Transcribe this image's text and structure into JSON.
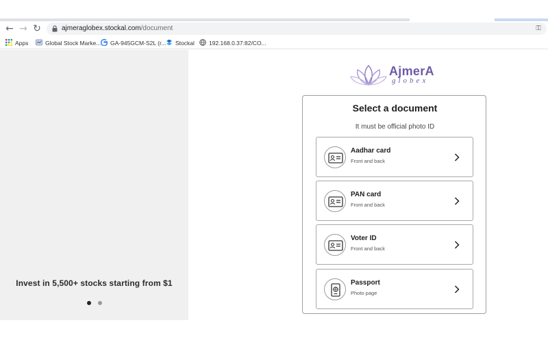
{
  "browser": {
    "url_host": "ajmeraglobex.stockal.com",
    "url_path": "/document",
    "bookmarks": [
      {
        "label": "Apps",
        "icon": "apps-grid-icon"
      },
      {
        "label": "Global Stock Marke...",
        "icon": "page-icon"
      },
      {
        "label": "GA-945GCM-S2L (r...",
        "icon": "google-icon"
      },
      {
        "label": "Stockal",
        "icon": "stockal-icon"
      },
      {
        "label": "192.168.0.37:82/CO...",
        "icon": "globe-icon"
      }
    ]
  },
  "left_panel": {
    "promo_text": "Invest in 5,500+ stocks starting from $1",
    "slides": 2,
    "active_slide": 1
  },
  "logo": {
    "name": "AjmerA",
    "tagline": "globex"
  },
  "document_picker": {
    "title": "Select a document",
    "subtitle": "It must be official photo ID",
    "options": [
      {
        "label": "Aadhar card",
        "description": "Front and back",
        "icon": "id-card-icon"
      },
      {
        "label": "PAN card",
        "description": "Front and back",
        "icon": "id-card-icon"
      },
      {
        "label": "Voter ID",
        "description": "Front and back",
        "icon": "id-card-icon"
      },
      {
        "label": "Passport",
        "description": "Photo page",
        "icon": "passport-icon"
      }
    ]
  },
  "colors": {
    "left_panel_bg": "#f0f0f1",
    "brand_purple": "#6d5aa8",
    "dot_active": "#222222",
    "dot_inactive": "#9a9a9a"
  }
}
